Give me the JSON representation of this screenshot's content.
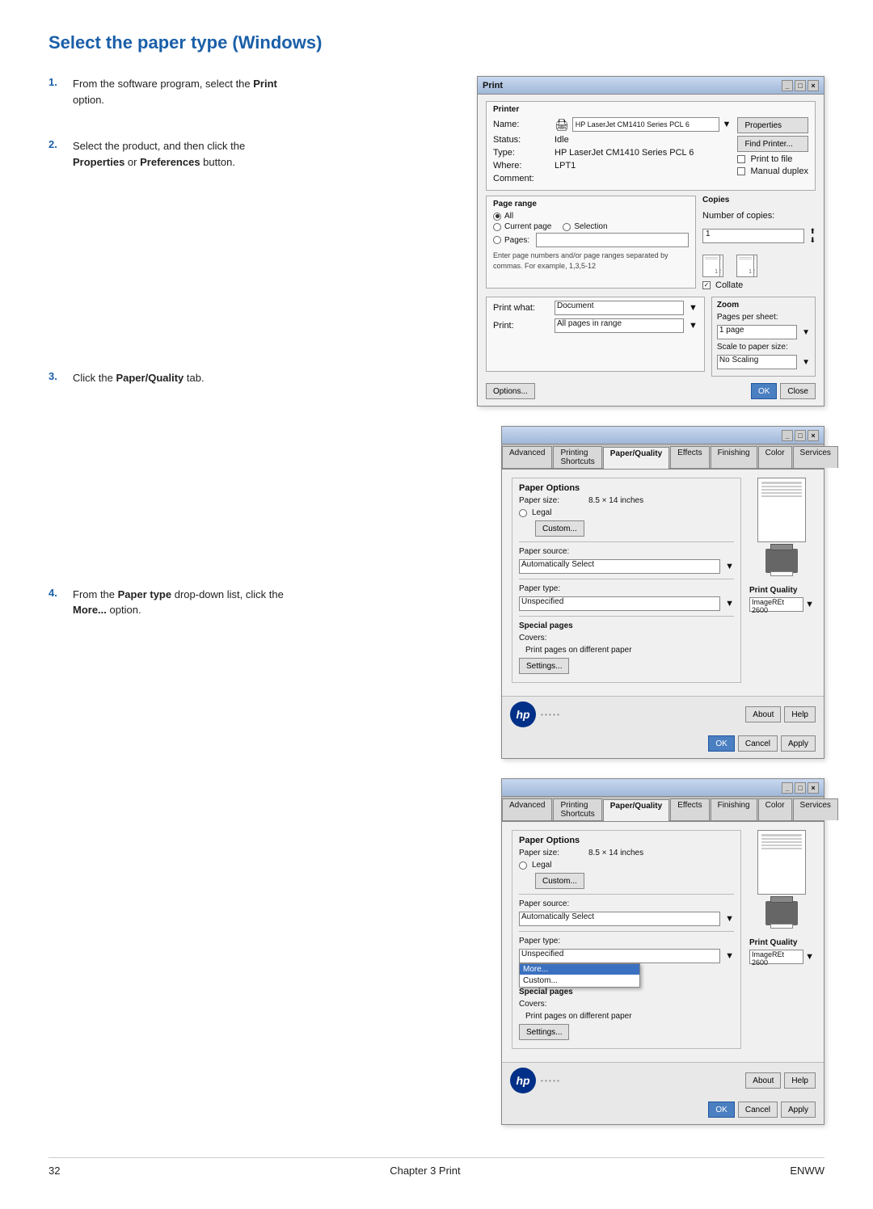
{
  "page": {
    "title": "Select the paper type (Windows)",
    "footer": {
      "page_number": "32",
      "chapter_label": "Chapter 3   Print",
      "brand": "ENWW"
    }
  },
  "steps": [
    {
      "number": "1.",
      "text": "From the software program, select the ",
      "bold": "Print",
      "text2": " option."
    },
    {
      "number": "2.",
      "text": "Select the product, and then click the ",
      "bold1": "Properties",
      "text2": " or ",
      "bold2": "Preferences",
      "text3": " button."
    },
    {
      "number": "3.",
      "text": "Click the ",
      "bold": "Paper/Quality",
      "text2": " tab."
    },
    {
      "number": "4.",
      "text": "From the ",
      "bold": "Paper type",
      "text2": " drop-down list, click the ",
      "bold2": "More...",
      "text3": " option."
    }
  ],
  "print_dialog": {
    "title": "Print",
    "printer_section": "Printer",
    "name_label": "Name:",
    "name_value": "HP LaserJet CM1410 Series PCL 6",
    "status_label": "Status:",
    "status_value": "Idle",
    "type_label": "Type:",
    "type_value": "HP LaserJet CM1410 Series PCL 6",
    "where_label": "Where:",
    "where_value": "LPT1",
    "comment_label": "Comment:",
    "properties_btn": "Properties",
    "find_printer_btn": "Find Printer...",
    "print_to_file": "Print to file",
    "manual_duplex": "Manual duplex",
    "page_range_title": "Page range",
    "all_label": "All",
    "current_page_label": "Current page",
    "selection_label": "Selection",
    "pages_label": "Pages:",
    "enter_page_hint": "Enter page numbers and/or page ranges separated by commas. For example, 1,3,5-12",
    "copies_title": "Copies",
    "num_copies_label": "Number of copies:",
    "num_copies_value": "1",
    "collate_label": "Collate",
    "print_what_label": "Print what:",
    "print_what_value": "Document",
    "print_label": "Print:",
    "print_value": "All pages in range",
    "zoom_title": "Zoom",
    "pages_per_sheet_label": "Pages per sheet:",
    "pages_per_sheet_value": "1 page",
    "scale_label": "Scale to paper size:",
    "scale_value": "No Scaling",
    "options_btn": "Options...",
    "ok_btn": "OK",
    "close_btn": "Close"
  },
  "paper_quality_dialog": {
    "title": "",
    "tabs": [
      "Advanced",
      "Printing Shortcuts",
      "Paper/Quality",
      "Effects",
      "Finishing",
      "Color",
      "Services"
    ],
    "active_tab": "Paper/Quality",
    "paper_options_title": "Paper Options",
    "paper_size_label": "Paper size:",
    "paper_size_value": "8.5 × 14 inches",
    "legal_label": "Legal",
    "custom_btn": "Custom...",
    "paper_source_label": "Paper source:",
    "paper_source_value": "Automatically Select",
    "paper_type_label": "Paper type:",
    "paper_type_value": "Unspecified",
    "special_pages_label": "Special pages",
    "covers_label": "Covers:",
    "diff_paper_label": "Print pages on different paper",
    "settings_btn": "Settings...",
    "print_quality_label": "Print Quality",
    "print_quality_value": "ImageREt 2600",
    "about_btn": "About",
    "help_btn": "Help",
    "ok_btn": "OK",
    "cancel_btn": "Cancel",
    "apply_btn": "Apply"
  },
  "paper_quality_dialog2": {
    "title": "",
    "tabs": [
      "Advanced",
      "Printing Shortcuts",
      "Paper/Quality",
      "Effects",
      "Finishing",
      "Color",
      "Services"
    ],
    "active_tab": "Paper/Quality",
    "paper_options_title": "Paper Options",
    "paper_size_label": "Paper size:",
    "paper_size_value": "8.5 × 14 inches",
    "legal_label": "Legal",
    "custom_btn": "Custom...",
    "paper_source_label": "Paper source:",
    "paper_source_value": "Automatically Select",
    "paper_type_label": "Paper type:",
    "paper_type_value": "Unspecified",
    "dropdown_items": [
      "More...",
      "Custom..."
    ],
    "highlighted_item": "More...",
    "special_pages_label": "Special pages",
    "covers_label": "Covers:",
    "diff_paper_label": "Print pages on different paper",
    "settings_btn": "Settings...",
    "print_quality_label": "Print Quality",
    "print_quality_value": "ImageREt 2600",
    "about_btn": "About",
    "help_btn": "Help",
    "ok_btn": "OK",
    "cancel_btn": "Cancel",
    "apply_btn": "Apply"
  },
  "colors": {
    "accent": "#1a5fa8",
    "dialog_bg": "#f0f0f0",
    "tab_active": "#f0f0f0",
    "highlight": "#3a70c0"
  }
}
